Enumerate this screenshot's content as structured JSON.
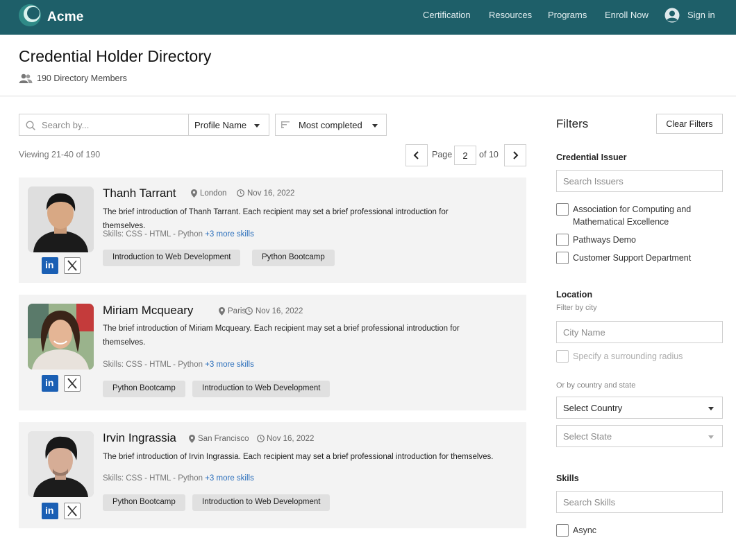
{
  "nav": {
    "brand": "Acme",
    "links": [
      "Certification",
      "Resources",
      "Programs",
      "Enroll Now"
    ],
    "signin": "Sign in"
  },
  "header": {
    "title": "Credential Holder Directory",
    "members": "190 Directory Members"
  },
  "toolbar": {
    "search_placeholder": "Search by...",
    "field": "Profile Name",
    "sort": "Most completed"
  },
  "pagination": {
    "viewing": "Viewing 21-40 of 190",
    "page_label": "Page",
    "current": "2",
    "of_label": "of 10"
  },
  "members": [
    {
      "name": "Thanh Tarrant",
      "location": "London",
      "date": "Nov 16, 2022",
      "intro": "The brief introduction of Thanh Tarrant. Each recipient may set a brief professional introduction for themselves.",
      "skills": "Skills: CSS - HTML - Python",
      "more": "+3 more skills",
      "tags": [
        "Introduction to Web Development",
        "Python Bootcamp"
      ]
    },
    {
      "name": "Miriam Mcqueary",
      "location": "Paris",
      "date": "Nov 16, 2022",
      "intro": "The brief introduction of Miriam Mcqueary. Each recipient may set a brief professional introduction for themselves.",
      "skills": "Skills: CSS - HTML - Python",
      "more": "+3 more skills",
      "tags": [
        "Python Bootcamp",
        "Introduction to Web Development"
      ]
    },
    {
      "name": "Irvin Ingrassia",
      "location": "San Francisco",
      "date": "Nov 16, 2022",
      "intro": "The brief introduction of Irvin Ingrassia. Each recipient may set a brief professional introduction for themselves.",
      "skills": "Skills: CSS - HTML - Python",
      "more": "+3 more skills",
      "tags": [
        "Python Bootcamp",
        "Introduction to Web Development"
      ]
    }
  ],
  "filters": {
    "title": "Filters",
    "clear": "Clear Filters",
    "issuer": {
      "heading": "Credential Issuer",
      "placeholder": "Search Issuers",
      "options": [
        "Association for Computing and Mathematical Excellence",
        "Pathways Demo",
        "Customer Support Department"
      ]
    },
    "location": {
      "heading": "Location",
      "sub": "Filter by city",
      "city_placeholder": "City Name",
      "radius": "Specify a surrounding radius",
      "country_sub": "Or by country and state",
      "country": "Select Country",
      "state": "Select State"
    },
    "skills": {
      "heading": "Skills",
      "placeholder": "Search Skills",
      "options": [
        "Async"
      ]
    }
  },
  "colors": {
    "nav_bg": "#1e5f69",
    "card_bg": "#f3f3f3",
    "link": "#2a6ebb",
    "linkedin": "#1a5fb4"
  }
}
